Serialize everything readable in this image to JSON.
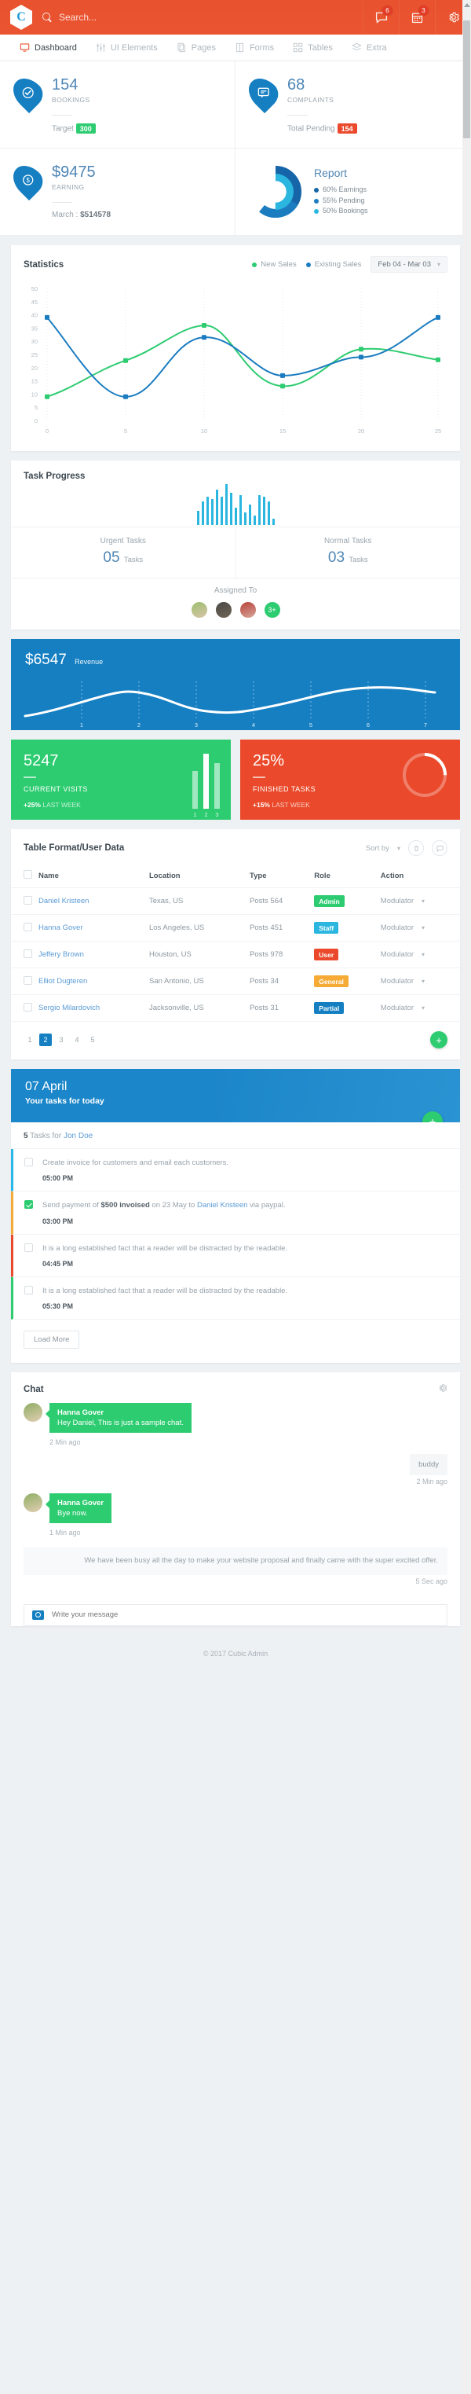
{
  "topbar": {
    "logo_letter": "C",
    "search_placeholder": "Search...",
    "search_value": "",
    "messages_badge": "6",
    "calendar_badge": "3"
  },
  "nav": {
    "items": [
      {
        "label": "Dashboard",
        "icon": "monitor-icon",
        "active": true
      },
      {
        "label": "UI Elements",
        "icon": "sliders-icon",
        "active": false
      },
      {
        "label": "Pages",
        "icon": "pages-icon",
        "active": false
      },
      {
        "label": "Forms",
        "icon": "form-icon",
        "active": false
      },
      {
        "label": "Tables",
        "icon": "grid-icon",
        "active": false
      },
      {
        "label": "Extra",
        "icon": "layers-icon",
        "active": false
      }
    ]
  },
  "kpis": [
    {
      "value": "154",
      "label": "BOOKINGS",
      "foot_label": "Target",
      "foot_pill": "300",
      "pill_color": "#2ecc71",
      "icon": "check-circle-icon"
    },
    {
      "value": "68",
      "label": "COMPLAINTS",
      "foot_label": "Total Pending",
      "foot_pill": "154",
      "pill_color": "#ea4a2b",
      "icon": "comment-icon"
    },
    {
      "value": "$9475",
      "label": "EARNING",
      "foot_label": "March :",
      "foot_strong": "$514578",
      "icon": "dollar-icon"
    }
  ],
  "report": {
    "title": "Report",
    "legend": [
      {
        "label": "60% Earnings",
        "color": "#1565a8",
        "value": 60
      },
      {
        "label": "55% Pending",
        "color": "#1b7cc0",
        "value": 55
      },
      {
        "label": "50% Bookings",
        "color": "#2bb6e0",
        "value": 50
      }
    ]
  },
  "statistics": {
    "title": "Statistics",
    "legend": [
      {
        "label": "New Sales",
        "color": "#2ecc71"
      },
      {
        "label": "Existing Sales",
        "color": "#1b7cc0"
      }
    ],
    "date_range": "Feb 04 - Mar 03"
  },
  "chart_data": {
    "type": "line",
    "title": "Statistics",
    "x": [
      0,
      5,
      10,
      15,
      20,
      25
    ],
    "series": [
      {
        "name": "New Sales",
        "color": "#2ecc71",
        "values": [
          9,
          23,
          36,
          13,
          27,
          23
        ]
      },
      {
        "name": "Existing Sales",
        "color": "#1b7cc0",
        "values": [
          39,
          9,
          31.5,
          17,
          24,
          39
        ]
      }
    ],
    "xticks": [
      "0",
      "5",
      "10",
      "15",
      "20",
      "25"
    ],
    "yticks": [
      "0",
      "5",
      "10",
      "15",
      "20",
      "25",
      "30",
      "35",
      "40",
      "45",
      "50"
    ],
    "xlim": [
      0,
      25
    ],
    "ylim": [
      0,
      50
    ],
    "xlabel": "",
    "ylabel": "",
    "grid": true,
    "legend_position": "top-right"
  },
  "task_progress": {
    "title": "Task Progress",
    "sparkline": [
      18,
      30,
      36,
      33,
      45,
      36,
      52,
      41,
      22,
      38,
      16,
      26,
      12,
      38,
      36,
      30,
      8
    ],
    "urgent_label": "Urgent Tasks",
    "urgent_value": "05",
    "urgent_unit": "Tasks",
    "normal_label": "Normal Tasks",
    "normal_value": "03",
    "normal_unit": "Tasks",
    "assigned_label": "Assigned To",
    "assigned_more": "3+"
  },
  "revenue": {
    "amount": "$6547",
    "label": "Revenue",
    "ticks": [
      "1",
      "2",
      "3",
      "4",
      "5",
      "6",
      "7"
    ]
  },
  "tiles": [
    {
      "value": "5247",
      "label": "CURRENT VISITS",
      "delta": "+25%",
      "delta_suffix": "LAST WEEK",
      "color": "#2ecc71",
      "bars": [
        48,
        70,
        58
      ],
      "bar_labels": [
        "1",
        "2",
        "3"
      ],
      "highlight_index": 1
    },
    {
      "value": "25%",
      "label": "FINISHED TASKS",
      "delta": "+15%",
      "delta_suffix": "LAST WEEK",
      "color": "#ea4a2b",
      "progress": 25
    }
  ],
  "table": {
    "title": "Table Format/User Data",
    "sort_label": "Sort by",
    "columns": [
      "",
      "Name",
      "Location",
      "Type",
      "Role",
      "Action"
    ],
    "rows": [
      {
        "name": "Daniel Kristeen",
        "location": "Texas, US",
        "type": "Posts 564",
        "role": "Admin",
        "role_color": "#2ecc71",
        "action": "Modulator"
      },
      {
        "name": "Hanna Gover",
        "location": "Los Angeles, US",
        "type": "Posts 451",
        "role": "Staff",
        "role_color": "#2bb6e0",
        "action": "Modulator"
      },
      {
        "name": "Jeffery Brown",
        "location": "Houston, US",
        "type": "Posts 978",
        "role": "User",
        "role_color": "#ea4a2b",
        "action": "Modulator"
      },
      {
        "name": "Elliot Dugteren",
        "location": "San Antonio, US",
        "type": "Posts 34",
        "role": "General",
        "role_color": "#f5ab35",
        "action": "Modulator"
      },
      {
        "name": "Sergio Milardovich",
        "location": "Jacksonville, US",
        "type": "Posts 31",
        "role": "Partial",
        "role_color": "#157fc2",
        "action": "Modulator"
      }
    ],
    "pages": [
      "1",
      "2",
      "3",
      "4",
      "5"
    ],
    "active_page": "2",
    "add_label": "+"
  },
  "today": {
    "date": "07 April",
    "subtitle": "Your tasks for today",
    "add_label": "+",
    "count": "5",
    "count_text": "Tasks for",
    "count_user": "Jon Doe",
    "tasks": [
      {
        "text_before": "Create invoice for customers and email each customers.",
        "text_bold": "",
        "text_after": "",
        "link": "",
        "time": "05:00 PM",
        "accent": "#29b6e8",
        "checked": false
      },
      {
        "text_before": "Send payment of ",
        "text_bold": "$500 invoised",
        "text_mid": " on 23 May to ",
        "link": "Daniel Kristeen",
        "text_after": " via paypal.",
        "time": "03:00 PM",
        "accent": "#f5ab35",
        "checked": true
      },
      {
        "text_before": "It is a long established fact that a reader will be distracted by the readable.",
        "time": "04:45 PM",
        "accent": "#ea4a2b",
        "checked": false
      },
      {
        "text_before": "It is a long established fact that a reader will be distracted by the readable.",
        "time": "05:30 PM",
        "accent": "#2ecc71",
        "checked": false
      }
    ],
    "load_more": "Load More"
  },
  "chat": {
    "title": "Chat",
    "messages": [
      {
        "direction": "in",
        "name": "Hanna Gover",
        "text": "Hey Daniel, This is just a sample chat.",
        "time": "2 Min ago"
      },
      {
        "direction": "out",
        "text": "buddy",
        "time": "2 Min ago"
      },
      {
        "direction": "in",
        "name": "Hanna Gover",
        "text": "Bye now.",
        "time": "1 Min ago"
      },
      {
        "direction": "out-wide",
        "text": "We have been busy all the day to make your website proposal and finally came with the super excited offer.",
        "time": "5 Sec ago"
      }
    ],
    "input_placeholder": "Write your message",
    "input_value": ""
  },
  "footer": {
    "text": "© 2017 Cubic Admin"
  }
}
